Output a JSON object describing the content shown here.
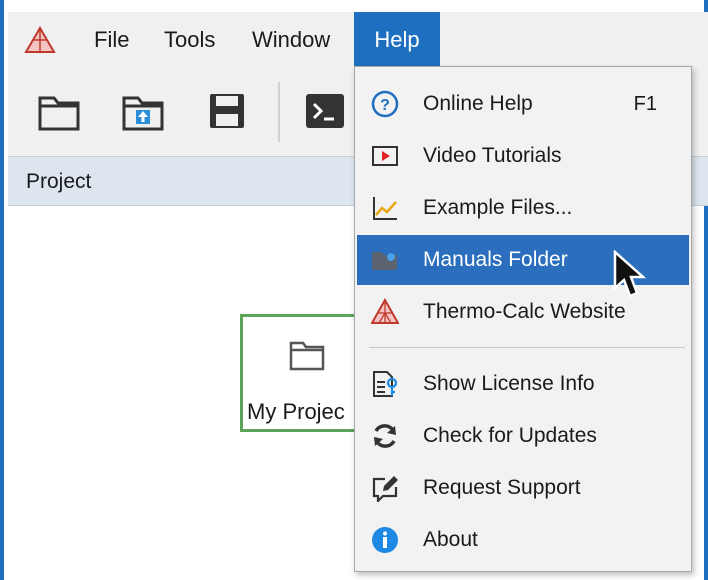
{
  "menubar": {
    "items": [
      {
        "label": "File"
      },
      {
        "label": "Tools"
      },
      {
        "label": "Window"
      },
      {
        "label": "Help"
      }
    ]
  },
  "panel": {
    "title": "Project"
  },
  "project_node": {
    "label": "My Projec"
  },
  "help_menu": {
    "items": [
      {
        "label": "Online Help",
        "shortcut": "F1",
        "icon": "help-circle-icon"
      },
      {
        "label": "Video Tutorials",
        "icon": "video-icon"
      },
      {
        "label": "Example Files...",
        "icon": "chart-icon"
      },
      {
        "label": "Manuals Folder",
        "icon": "folder-wrench-icon",
        "highlighted": true
      },
      {
        "label": "Thermo-Calc Website",
        "icon": "thermocalc-logo-icon"
      },
      {
        "label": "Show License Info",
        "icon": "license-icon"
      },
      {
        "label": "Check for Updates",
        "icon": "refresh-icon"
      },
      {
        "label": "Request Support",
        "icon": "edit-icon"
      },
      {
        "label": "About",
        "icon": "info-icon"
      }
    ]
  },
  "colors": {
    "accent": "#1e6fbf",
    "highlight": "#2a6ebd",
    "project_border": "#5aa55a"
  }
}
